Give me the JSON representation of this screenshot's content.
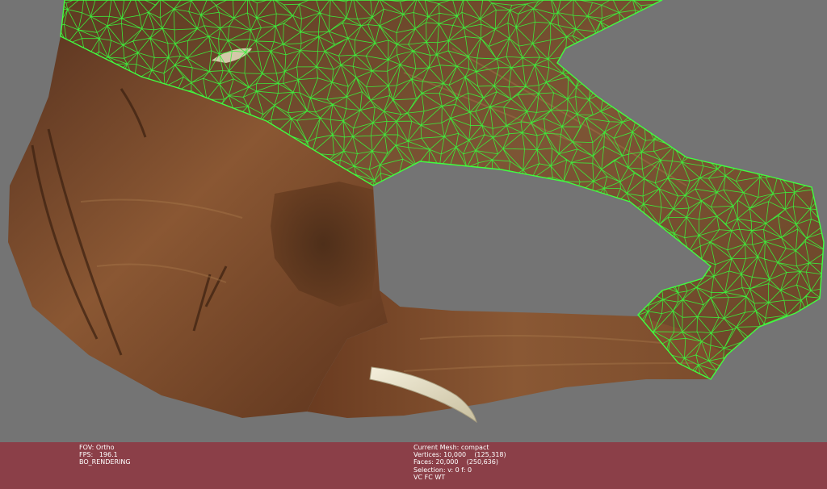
{
  "viewer": {
    "left_info": {
      "fov": "FOV: Ortho",
      "fps": "FPS:   196.1",
      "mode": "BO_RENDERING"
    },
    "right_info": {
      "current_mesh": "Current Mesh: compact",
      "vertices": "Vertices: 10,000    (125,318)",
      "faces": "Faces: 20,000    (250,636)",
      "selection": "Selection: v: 0 f: 0",
      "flags": "VC FC WT"
    }
  },
  "colors": {
    "background": "#747474",
    "wireframe": "#33ee33",
    "info_bar": "#8b3f48",
    "wood_dark": "#4a2a16",
    "wood_mid": "#7a4a2a",
    "wood_light": "#9a6a45",
    "tusk": "#e8e2cc"
  }
}
